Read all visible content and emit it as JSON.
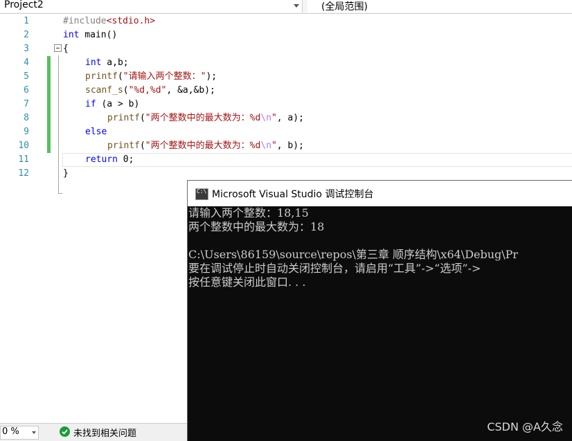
{
  "navbar": {
    "project": "Project2",
    "scope": "(全局范围)"
  },
  "editor": {
    "line_numbers": [
      "1",
      "2",
      "3",
      "4",
      "5",
      "6",
      "7",
      "8",
      "9",
      "10",
      "11",
      "12"
    ],
    "code": {
      "l1_pp": "#include",
      "l1_hdr": "<stdio.h>",
      "l2_kw": "int",
      "l2_rest": " main()",
      "l3": "{",
      "l4_kw": "int",
      "l4_rest": " a,b;",
      "l5_fn": "printf",
      "l5_open": "(",
      "l5_str": "\"请输入两个整数：\"",
      "l5_close": ");",
      "l6_fn": "scanf_s",
      "l6_open": "(",
      "l6_str": "\"%d,%d\"",
      "l6_rest": ", &a,&b);",
      "l7_kw": "if",
      "l7_rest": " (a > b)",
      "l8_fn": "printf",
      "l8_open": "(",
      "l8_str1": "\"两个整数中的最大数为：%d",
      "l8_esc": "\\n",
      "l8_str2": "\"",
      "l8_rest": ", a);",
      "l9_kw": "else",
      "l10_fn": "printf",
      "l10_open": "(",
      "l10_str1": "\"两个整数中的最大数为：%d",
      "l10_esc": "\\n",
      "l10_str2": "\"",
      "l10_rest": ", b);",
      "l11_kw": "return",
      "l11_rest": " 0;",
      "l12": "}"
    }
  },
  "statusbar": {
    "zoom": "0 %",
    "issues": "未找到相关问题"
  },
  "console": {
    "icon_label": "C:\\",
    "title": "Microsoft Visual Studio 调试控制台",
    "lines": [
      "请输入两个整数：18,15",
      "两个整数中的最大数为：18",
      "",
      "C:\\Users\\86159\\source\\repos\\第三章 顺序结构\\x64\\Debug\\Pr",
      "要在调试停止时自动关闭控制台，请启用“工具”->“选项”->",
      "按任意键关闭此窗口. . ."
    ],
    "watermark": "CSDN @A久念"
  },
  "colors": {
    "keyword": "#0000ff",
    "string": "#a31515",
    "line_number": "#2b91af",
    "change_marker": "#57c05b",
    "console_bg": "#0c0c0c"
  }
}
